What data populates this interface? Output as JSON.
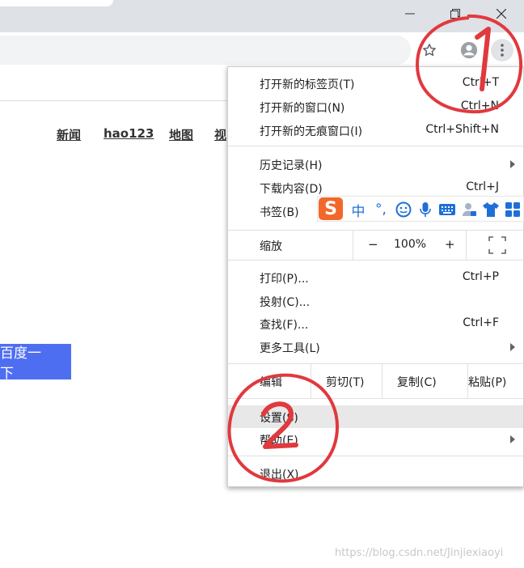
{
  "window": {
    "minimize_label": "minimize",
    "maximize_label": "maximize",
    "close_label": "close"
  },
  "page": {
    "links": [
      "新闻",
      "hao123",
      "地图",
      "视"
    ],
    "search_button": "百度一下"
  },
  "menu": {
    "items": {
      "new_tab": {
        "label": "打开新的标签页(T)",
        "shortcut": "Ctrl+T"
      },
      "new_window": {
        "label": "打开新的窗口(N)",
        "shortcut": "Ctrl+N"
      },
      "incognito": {
        "label": "打开新的无痕窗口(I)",
        "shortcut": "Ctrl+Shift+N"
      },
      "history": {
        "label": "历史记录(H)"
      },
      "downloads": {
        "label": "下载内容(D)",
        "shortcut": "Ctrl+J"
      },
      "bookmarks": {
        "label": "书签(B)"
      },
      "print": {
        "label": "打印(P)...",
        "shortcut": "Ctrl+P"
      },
      "cast": {
        "label": "投射(C)..."
      },
      "find": {
        "label": "查找(F)...",
        "shortcut": "Ctrl+F"
      },
      "more_tools": {
        "label": "更多工具(L)"
      },
      "settings": {
        "label": "设置(S)"
      },
      "help": {
        "label": "帮助(E)"
      },
      "exit": {
        "label": "退出(X)"
      }
    },
    "zoom": {
      "label": "缩放",
      "minus": "−",
      "value": "100%",
      "plus": "+"
    },
    "edit": {
      "label": "编辑",
      "cut": "剪切(T)",
      "copy": "复制(C)",
      "paste": "粘贴(P)"
    }
  },
  "ime": {
    "logo": "S",
    "mode": "中",
    "punct": "°,"
  },
  "annotations": {
    "step1": "1",
    "step2": "2",
    "color": "#e0393e"
  },
  "watermark": "https://blog.csdn.net/Jinjiexiaoyi"
}
